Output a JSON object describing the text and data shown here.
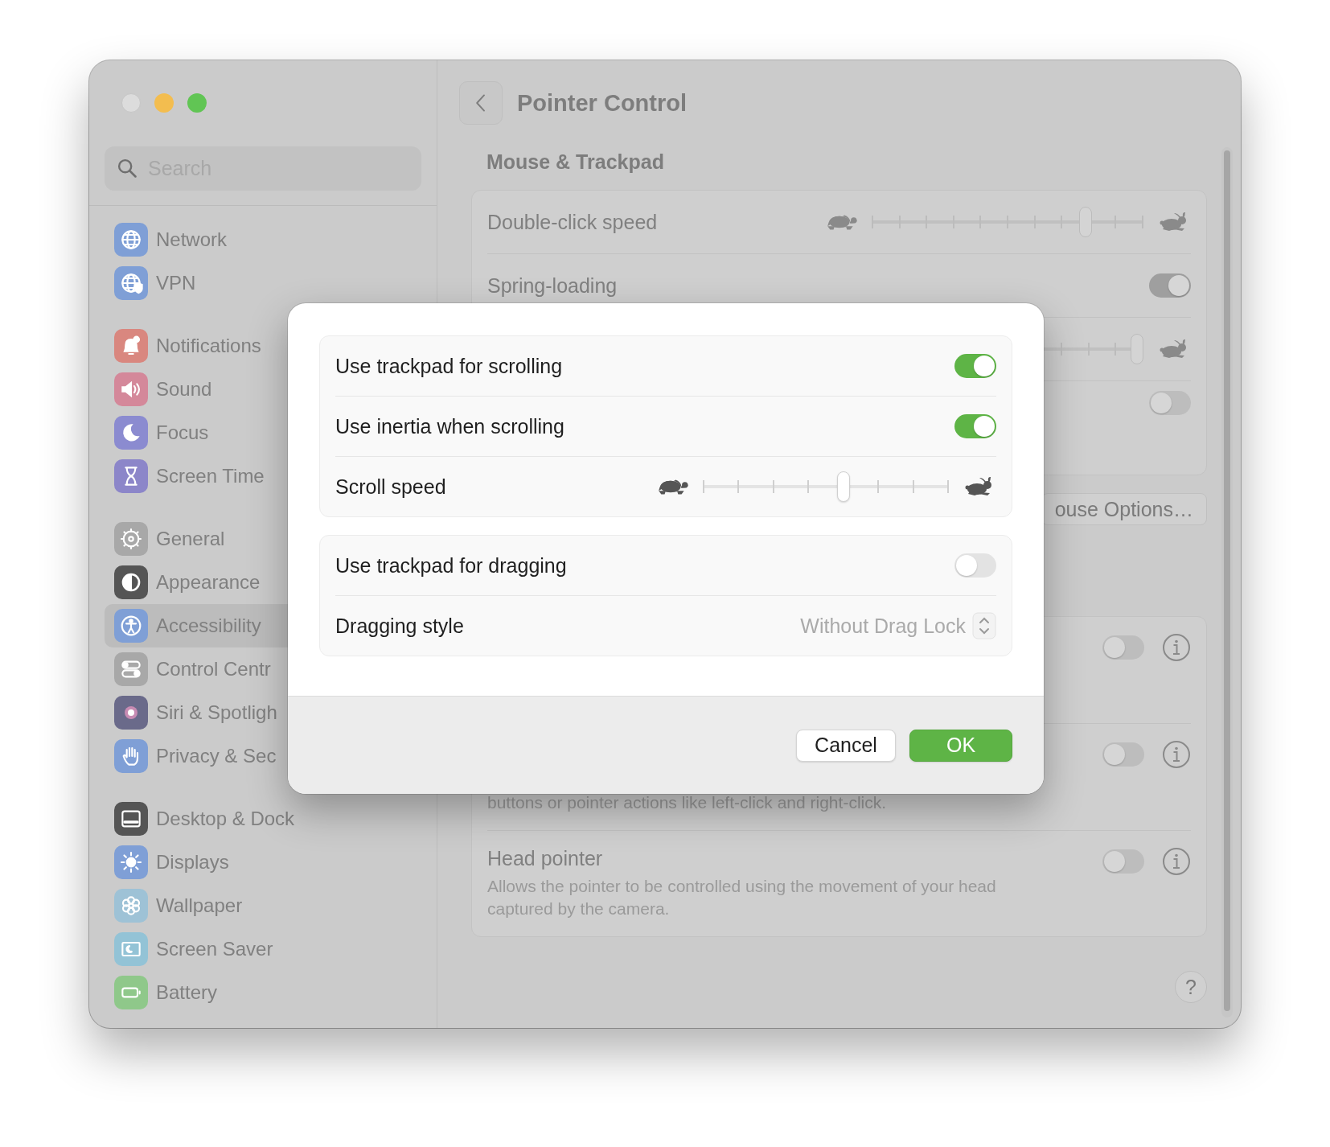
{
  "sidebar": {
    "search": {
      "placeholder": "Search"
    },
    "groups": [
      [
        {
          "label": "Network",
          "kind": "globe",
          "color": "#7f9fd6",
          "selected": false
        },
        {
          "label": "VPN",
          "kind": "vpn",
          "color": "#7f9fd6",
          "selected": false
        }
      ],
      [
        {
          "label": "Notifications",
          "kind": "bell",
          "color": "#d9877f",
          "selected": false
        },
        {
          "label": "Sound",
          "kind": "speaker",
          "color": "#d4889a",
          "selected": false
        },
        {
          "label": "Focus",
          "kind": "moon",
          "color": "#8b8bd0",
          "selected": false
        },
        {
          "label": "Screen Time",
          "kind": "hourglass",
          "color": "#8c86c9",
          "selected": false
        }
      ],
      [
        {
          "label": "General",
          "kind": "gear",
          "color": "#a8a8a8",
          "selected": false
        },
        {
          "label": "Appearance",
          "kind": "contrast",
          "color": "#555555",
          "selected": false
        },
        {
          "label": "Accessibility",
          "kind": "person",
          "color": "#7f9fd6",
          "selected": true
        },
        {
          "label": "Control Centr",
          "kind": "switches",
          "color": "#a8a8a8",
          "selected": false
        },
        {
          "label": "Siri & Spotligh",
          "kind": "orb",
          "color": "#6a6a8a",
          "selected": false
        },
        {
          "label": "Privacy & Sec",
          "kind": "hand",
          "color": "#7f9fd6",
          "selected": false
        }
      ],
      [
        {
          "label": "Desktop & Dock",
          "kind": "dock",
          "color": "#555555",
          "selected": false
        },
        {
          "label": "Displays",
          "kind": "sun",
          "color": "#7f9fd6",
          "selected": false
        },
        {
          "label": "Wallpaper",
          "kind": "flower",
          "color": "#9ec2d6",
          "selected": false
        },
        {
          "label": "Screen Saver",
          "kind": "screen",
          "color": "#93c3d6",
          "selected": false
        },
        {
          "label": "Battery",
          "kind": "battery",
          "color": "#8fc88a",
          "selected": false
        }
      ]
    ]
  },
  "header": {
    "title": "Pointer Control"
  },
  "section": {
    "title": "Mouse & Trackpad"
  },
  "settings": [
    {
      "kind": "slider",
      "label": "Double-click speed",
      "level": 0.79
    },
    {
      "kind": "toggle",
      "label": "Spring-loading",
      "on": true
    },
    {
      "kind": "slider",
      "level": 0.98
    },
    {
      "kind": "toggle",
      "on": false
    }
  ],
  "mouse_options_button": "ouse Options…",
  "accessibility_rows": [
    {
      "on": false
    },
    {
      "description": "buttons or pointer actions like left-click and right-click.",
      "on": false
    },
    {
      "label": "Head pointer",
      "description": "Allows the pointer to be controlled using the movement of your head captured by the camera.",
      "on": false
    }
  ],
  "help_button": "?",
  "dialog": {
    "groups": [
      [
        {
          "kind": "toggle",
          "label": "Use trackpad for scrolling",
          "on": true
        },
        {
          "kind": "toggle",
          "label": "Use inertia when scrolling",
          "on": true
        },
        {
          "kind": "slider",
          "label": "Scroll speed",
          "level": 0.571
        }
      ],
      [
        {
          "kind": "toggle",
          "label": "Use trackpad for dragging",
          "on": false
        },
        {
          "kind": "popup",
          "label": "Dragging style",
          "value": "Without Drag Lock",
          "disabled": true
        }
      ]
    ],
    "buttons": [
      {
        "label": "Cancel",
        "default": false
      },
      {
        "label": "OK",
        "default": true
      }
    ]
  }
}
